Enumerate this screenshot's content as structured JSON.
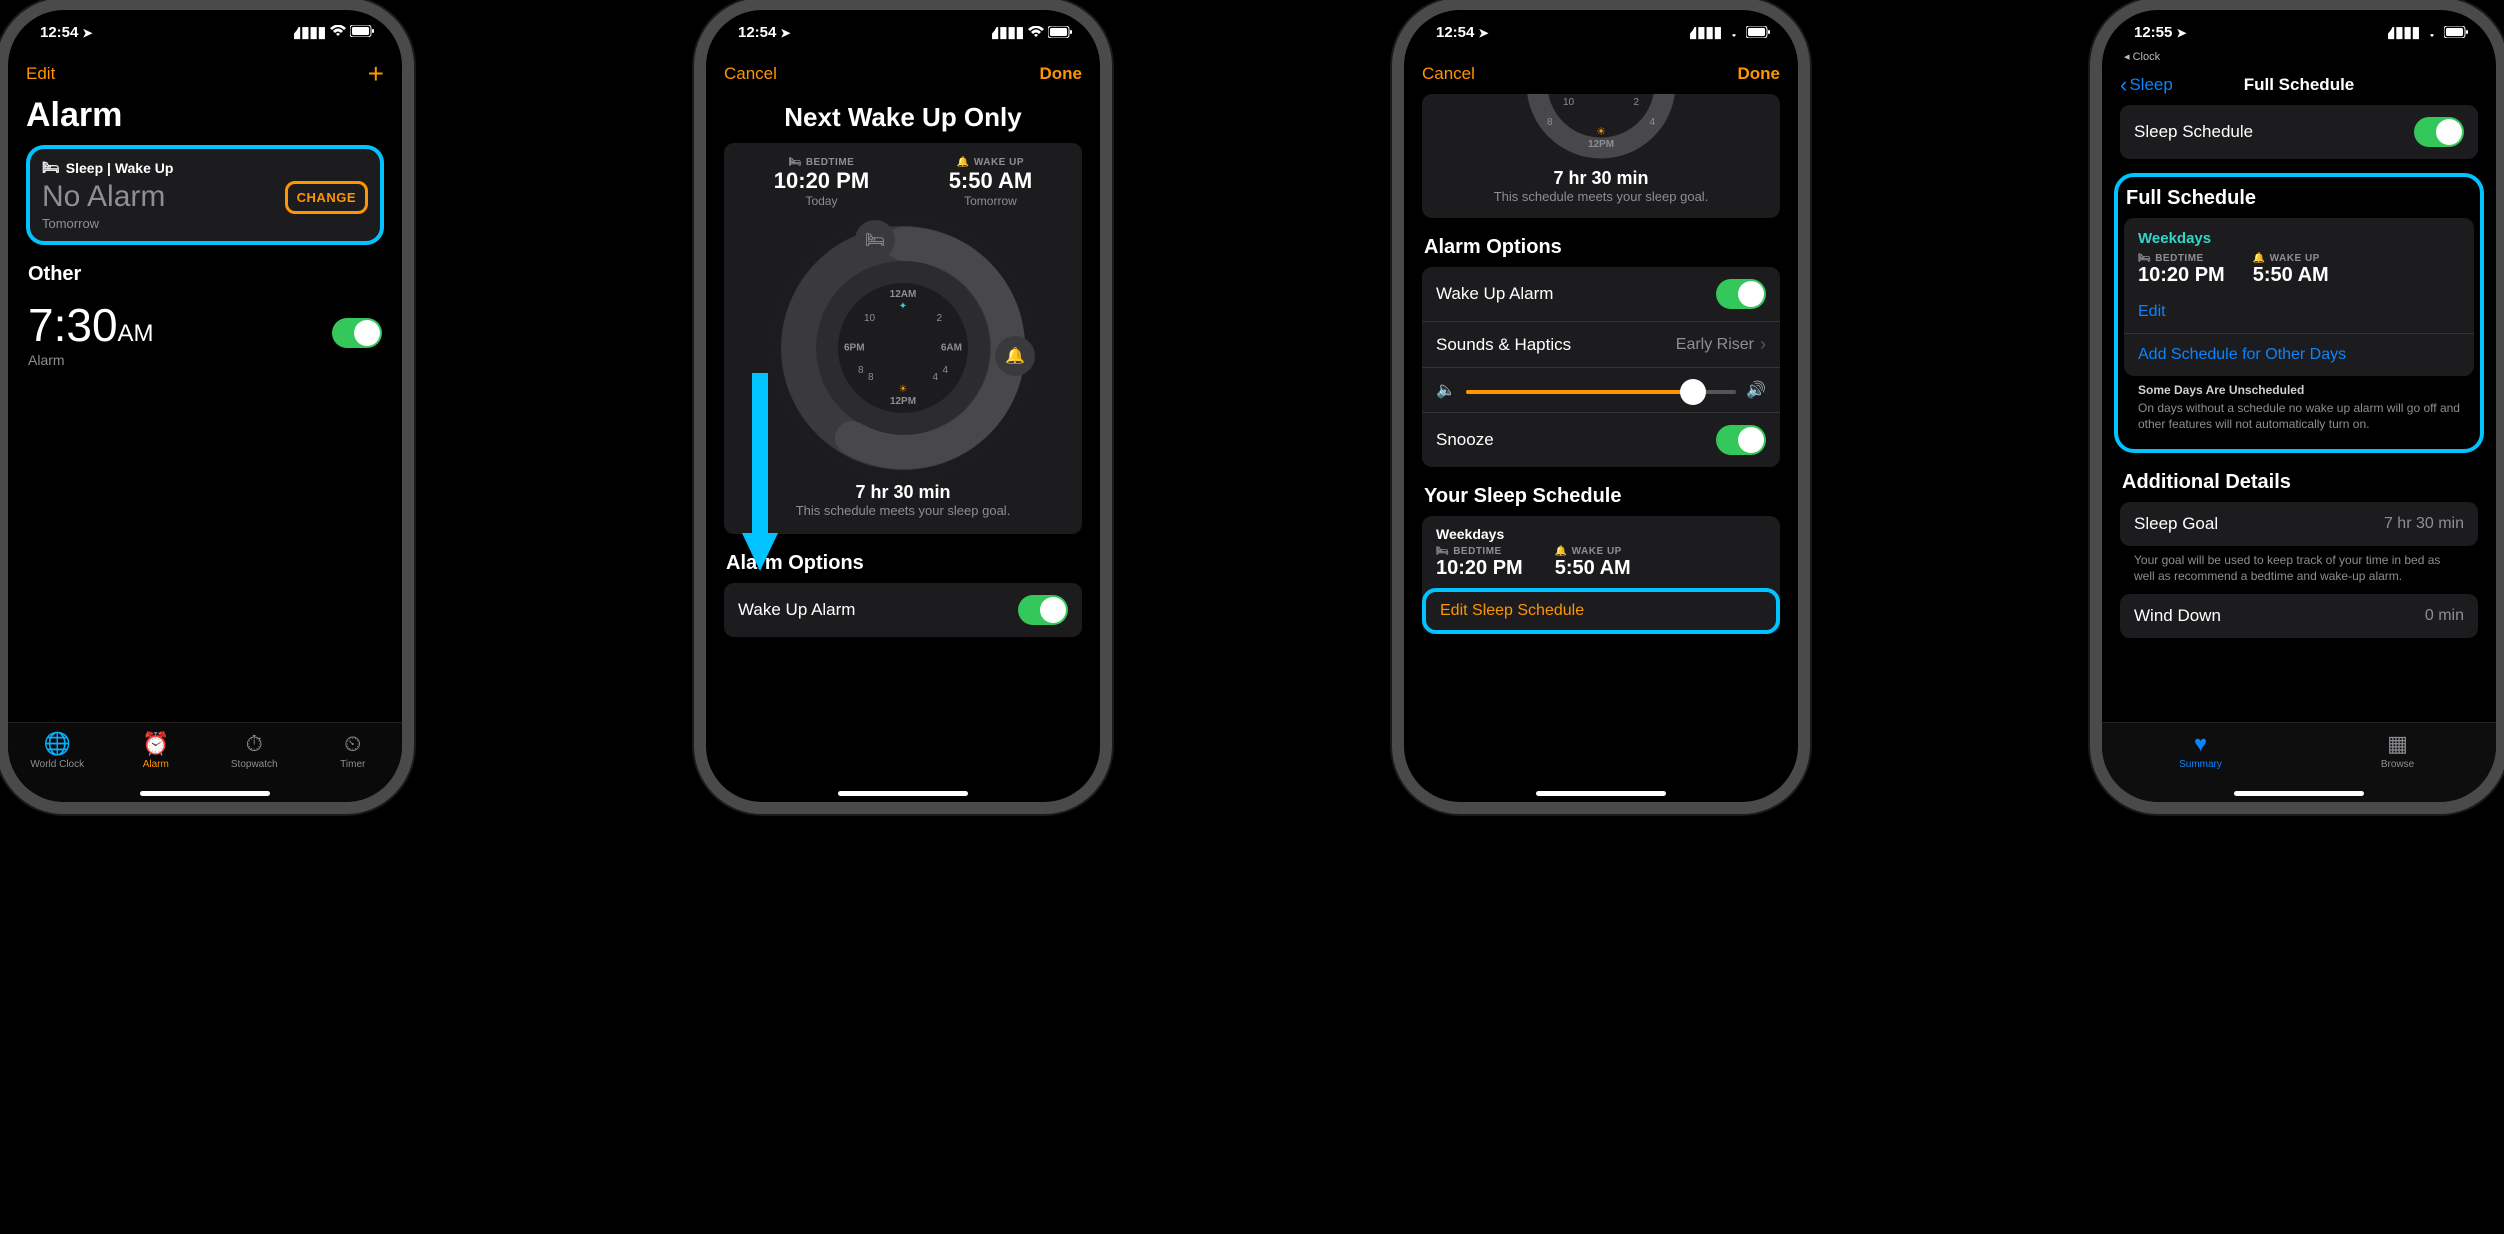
{
  "status": {
    "time1": "12:54",
    "time2": "12:55",
    "loc_arrow": "➤"
  },
  "p1": {
    "edit": "Edit",
    "title": "Alarm",
    "sleep_header": "Sleep | Wake Up",
    "no_alarm": "No Alarm",
    "tomorrow": "Tomorrow",
    "change": "CHANGE",
    "other": "Other",
    "other_time": "7:30",
    "other_ampm": "AM",
    "other_label": "Alarm",
    "tabs": {
      "world": "World Clock",
      "alarm": "Alarm",
      "stopwatch": "Stopwatch",
      "timer": "Timer"
    }
  },
  "p2": {
    "cancel": "Cancel",
    "done": "Done",
    "title": "Next Wake Up Only",
    "bed_cap": "BEDTIME",
    "bed_time": "10:20 PM",
    "bed_sub": "Today",
    "wake_cap": "WAKE UP",
    "wake_time": "5:50 AM",
    "wake_sub": "Tomorrow",
    "duration": "7 hr 30 min",
    "goal_msg": "This schedule meets your sleep goal.",
    "opts_head": "Alarm Options",
    "wake_alarm": "Wake Up Alarm",
    "dial": {
      "top": "12AM",
      "right": "6AM",
      "bottom": "12PM",
      "left": "6PM"
    }
  },
  "p3": {
    "cancel": "Cancel",
    "done": "Done",
    "dial_bottom": "12PM",
    "duration": "7 hr 30 min",
    "goal_msg": "This schedule meets your sleep goal.",
    "opts_head": "Alarm Options",
    "wake_alarm": "Wake Up Alarm",
    "sounds": "Sounds & Haptics",
    "sounds_val": "Early Riser",
    "snooze": "Snooze",
    "sched_head": "Your Sleep Schedule",
    "days": "Weekdays",
    "bed_cap": "BEDTIME",
    "bed_time": "10:20 PM",
    "wake_cap": "WAKE UP",
    "wake_time": "5:50 AM",
    "edit_link": "Edit Sleep Schedule"
  },
  "p4": {
    "back_app": "Clock",
    "back": "Sleep",
    "title": "Full Schedule",
    "sched_row": "Sleep Schedule",
    "full_head": "Full Schedule",
    "days": "Weekdays",
    "bed_cap": "BEDTIME",
    "bed_time": "10:20 PM",
    "wake_cap": "WAKE UP",
    "wake_time": "5:50 AM",
    "edit": "Edit",
    "add": "Add Schedule for Other Days",
    "unsched_h": "Some Days Are Unscheduled",
    "unsched_b": "On days without a schedule no wake up alarm will go off and other features will not automatically turn on.",
    "add_head": "Additional Details",
    "goal": "Sleep Goal",
    "goal_val": "7 hr 30 min",
    "goal_foot": "Your goal will be used to keep track of your time in bed as well as recommend a bedtime and wake-up alarm.",
    "wind": "Wind Down",
    "wind_val": "0 min",
    "tabs": {
      "summary": "Summary",
      "browse": "Browse"
    }
  }
}
